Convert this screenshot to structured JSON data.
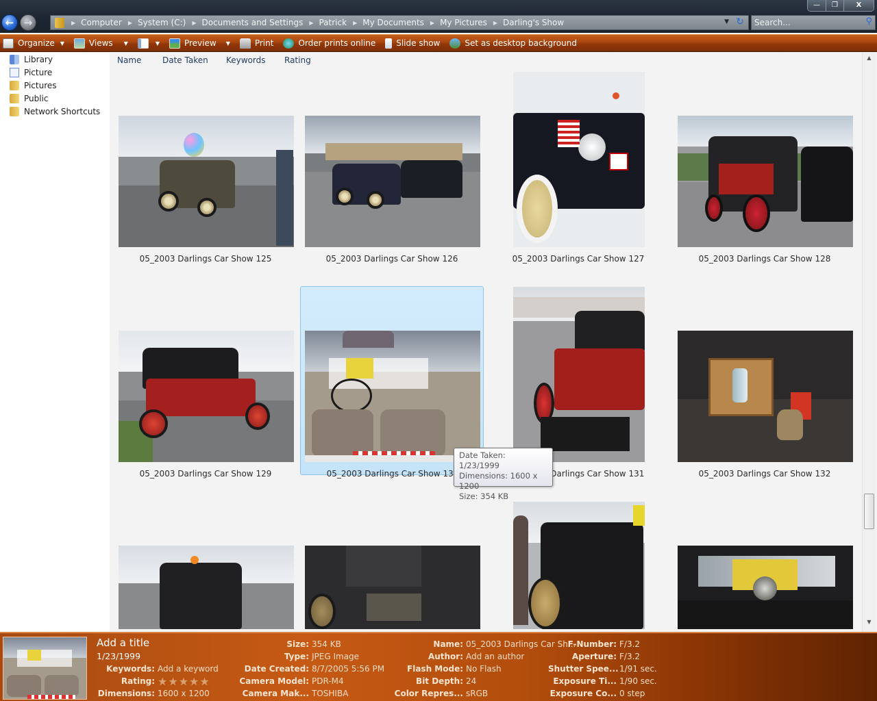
{
  "window": {
    "caption_buttons": [
      "minimize",
      "restore",
      "close"
    ]
  },
  "address_bar": {
    "breadcrumbs": [
      "Computer",
      "System (C:)",
      "Documents and Settings",
      "Patrick",
      "My Documents",
      "My Pictures",
      "Darling's Show"
    ]
  },
  "search": {
    "placeholder": "Search..."
  },
  "toolbar": {
    "organize": "Organize",
    "views": "Views",
    "preview": "Preview",
    "print": "Print",
    "order_prints": "Order prints online",
    "slide_show": "Slide show",
    "set_desktop": "Set as desktop background"
  },
  "nav_pane": {
    "items": [
      {
        "label": "Library",
        "icon": "library-icon"
      },
      {
        "label": "Picture",
        "icon": "picture-icon"
      },
      {
        "label": "Pictures",
        "icon": "folder-icon"
      },
      {
        "label": "Public",
        "icon": "folder-icon"
      },
      {
        "label": "Network Shortcuts",
        "icon": "folder-icon"
      }
    ]
  },
  "columns": [
    "Name",
    "Date Taken",
    "Keywords",
    "Rating"
  ],
  "files": [
    {
      "name": "05_2003 Darlings Car Show 125"
    },
    {
      "name": "05_2003 Darlings Car Show 126"
    },
    {
      "name": "05_2003 Darlings Car Show 127"
    },
    {
      "name": "05_2003 Darlings Car Show 128"
    },
    {
      "name": "05_2003 Darlings Car Show 129"
    },
    {
      "name": "05_2003 Darlings Car Show 130",
      "selected": true
    },
    {
      "name": "05_2003 Darlings Car Show 131"
    },
    {
      "name": "05_2003 Darlings Car Show 132"
    },
    {
      "name": ""
    },
    {
      "name": ""
    },
    {
      "name": ""
    },
    {
      "name": ""
    }
  ],
  "tooltip": {
    "date_taken": "Date Taken: 1/23/1999",
    "dimensions": "Dimensions: 1600 x 1200",
    "size": "Size: 354 KB"
  },
  "details": {
    "title": "Add a title",
    "date": "1/23/1999",
    "rating_stars": 0,
    "rating_max": 5,
    "col1": [
      {
        "k": "Keywords:",
        "v": "Add a keyword"
      },
      {
        "k": "Rating:",
        "v": ""
      },
      {
        "k": "Dimensions:",
        "v": "1600 x 1200"
      }
    ],
    "col2": [
      {
        "k": "Size:",
        "v": "354 KB"
      },
      {
        "k": "Type:",
        "v": "JPEG Image"
      },
      {
        "k": "Date Created:",
        "v": "8/7/2005 5:56 PM"
      },
      {
        "k": "Camera Model:",
        "v": "PDR-M4"
      },
      {
        "k": "Camera Mak...",
        "v": "TOSHIBA"
      }
    ],
    "col3": [
      {
        "k": "Name:",
        "v": "05_2003 Darlings Car Sh..."
      },
      {
        "k": "Author:",
        "v": "Add an author"
      },
      {
        "k": "Flash Mode:",
        "v": "No Flash"
      },
      {
        "k": "Bit Depth:",
        "v": "24"
      },
      {
        "k": "Color Repres...",
        "v": "sRGB"
      }
    ],
    "col4": [
      {
        "k": "F-Number:",
        "v": "F/3.2"
      },
      {
        "k": "Aperture:",
        "v": "F/3.2"
      },
      {
        "k": "Shutter Spee...",
        "v": "1/91 sec."
      },
      {
        "k": "Exposure Ti...",
        "v": "1/90 sec."
      },
      {
        "k": "Exposure Co...",
        "v": "0 step"
      }
    ]
  },
  "colors": {
    "toolbar": "#a9450f",
    "details_pane": "#c65a14",
    "selection": "#c5e4f9"
  }
}
